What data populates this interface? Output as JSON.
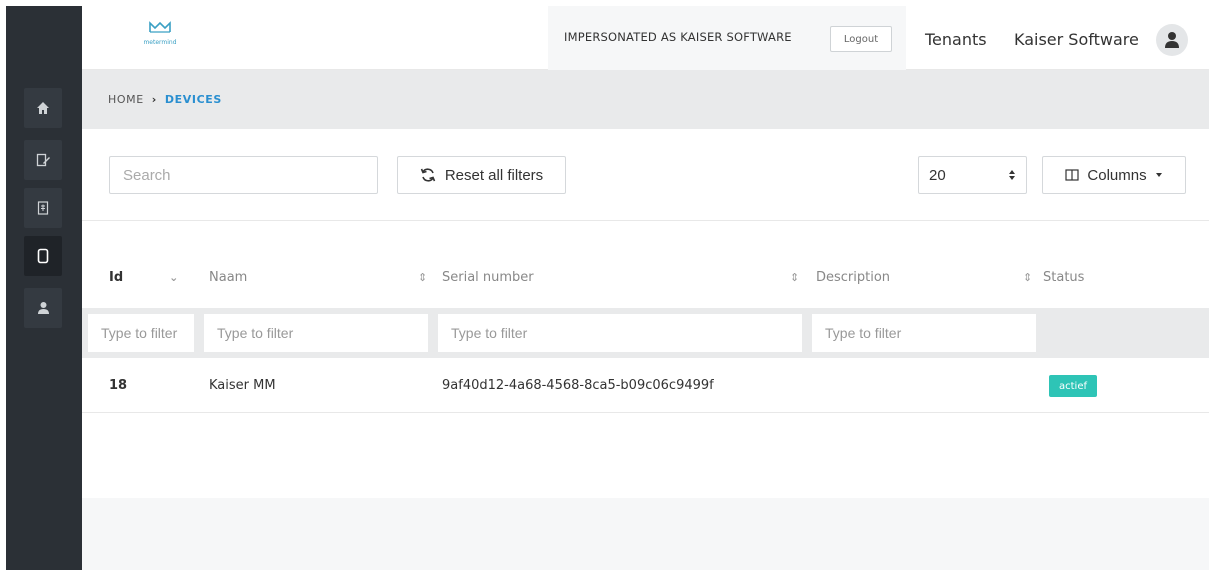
{
  "sidebar": {
    "items": [
      {
        "name": "home",
        "icon": "home-icon"
      },
      {
        "name": "edit",
        "icon": "edit-icon"
      },
      {
        "name": "billing",
        "icon": "receipt-icon"
      },
      {
        "name": "devices",
        "icon": "device-icon",
        "active": true
      },
      {
        "name": "users",
        "icon": "user-icon"
      }
    ]
  },
  "header": {
    "logo_text": "metermind",
    "impersonation_text": "IMPERSONATED AS KAISER SOFTWARE",
    "logout_label": "Logout",
    "tenants_label": "Tenants",
    "company_label": "Kaiser Software"
  },
  "breadcrumb": {
    "home": "HOME",
    "separator": "›",
    "current": "DEVICES"
  },
  "toolbar": {
    "search_placeholder": "Search",
    "reset_label": "Reset all filters",
    "page_size": "20",
    "columns_label": "Columns"
  },
  "table": {
    "columns": [
      {
        "key": "id",
        "label": "Id",
        "sort": "⌄"
      },
      {
        "key": "naam",
        "label": "Naam",
        "sort": "⇕"
      },
      {
        "key": "serial",
        "label": "Serial number",
        "sort": "⇕"
      },
      {
        "key": "description",
        "label": "Description",
        "sort": "⇕"
      },
      {
        "key": "status",
        "label": "Status",
        "sort": "⇕"
      }
    ],
    "filter_placeholder": "Type to filter",
    "rows": [
      {
        "id": "18",
        "naam": "Kaiser MM",
        "serial": "9af40d12-4a68-4568-8ca5-b09c06c9499f",
        "description": "",
        "status": "actief"
      }
    ]
  },
  "colors": {
    "sidebar_bg": "#2b3036",
    "accent_blue": "#2a8fd0",
    "status_active": "#2ec4b6"
  }
}
